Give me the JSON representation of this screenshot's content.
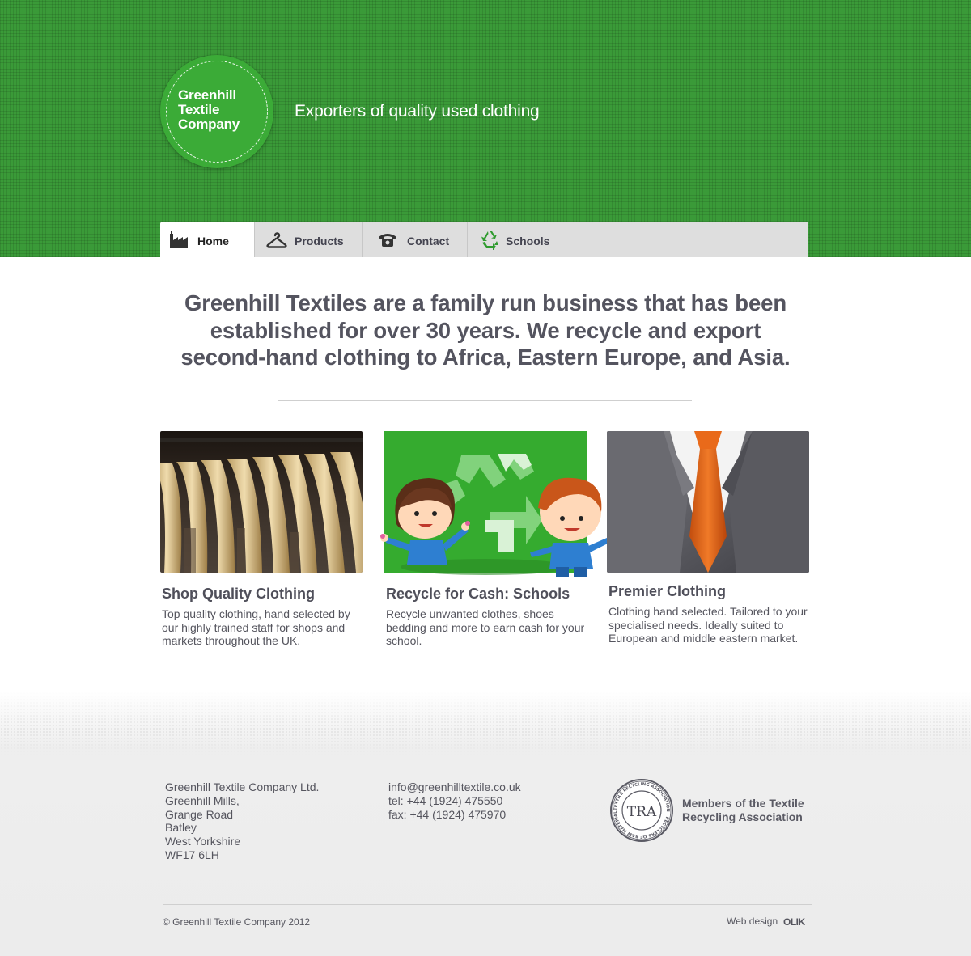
{
  "brand": {
    "logo_lines": [
      "Greenhill",
      "Textile",
      "Company"
    ],
    "tagline": "Exporters of quality used clothing",
    "colors": {
      "brand_green": "#3a9a38",
      "logo_green": "#3bab37",
      "text": "#54545f"
    }
  },
  "nav": {
    "tabs": [
      {
        "label": "Home",
        "icon": "factory-icon",
        "active": true
      },
      {
        "label": "Products",
        "icon": "hanger-icon",
        "active": false
      },
      {
        "label": "Contact",
        "icon": "phone-icon",
        "active": false
      },
      {
        "label": "Schools",
        "icon": "recycle-icon",
        "active": false
      }
    ]
  },
  "intro": {
    "lines": [
      "Greenhill Textiles are a family run business that has been",
      "established for over 30 years. We recycle and export",
      "second-hand clothing to Africa, Eastern Europe, and Asia."
    ]
  },
  "features": [
    {
      "title": "Shop Quality Clothing",
      "text": "Top quality clothing, hand selected by our highly trained staff for shops and markets throughout the UK.",
      "image": "clothes-hangers-photo"
    },
    {
      "title": "Recycle for Cash: Schools",
      "text": "Recycle unwanted clothes, shoes bedding and more to earn cash for your school.",
      "image": "kids-recycle-illustration"
    },
    {
      "title": "Premier Clothing",
      "text": "Clothing hand selected. Tailored to your specialised needs. Ideally suited to European and middle eastern market.",
      "image": "suit-tie-photo"
    }
  ],
  "footer": {
    "address_lines": [
      "Greenhill Textile Company Ltd.",
      "Greenhill Mills,",
      "Grange Road",
      "Batley",
      "West Yorkshire",
      "WF17 6LH"
    ],
    "email": "info@greenhilltextile.co.uk",
    "tel": "tel: +44 (1924) 475550",
    "fax": "fax: +44 (1924) 475970",
    "tra_badge": "TRA",
    "tra_badge_ring": "TEXTILE RECYCLING ASSOCIATION · RECYCLERS OF RAW MATERIAL FOR INDUSTRY",
    "tra_lines": [
      "Members of the Textile",
      "Recycling Association"
    ],
    "copyright": "© Greenhill Textile Company 2012",
    "web_design_label": "Web design",
    "web_design_brand": "OLIK"
  }
}
